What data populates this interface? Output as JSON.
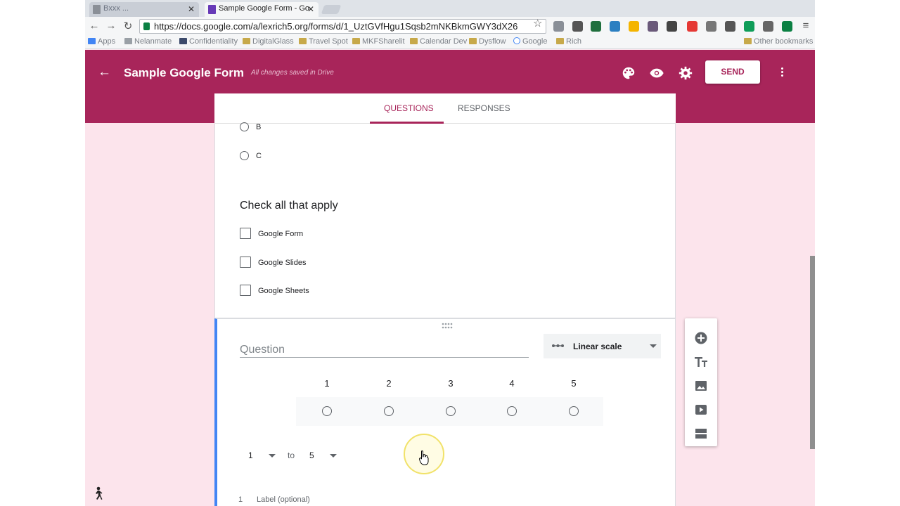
{
  "browser": {
    "tabs": [
      {
        "label": "Bxxx  ...",
        "active": false
      },
      {
        "label": "Sample Google Form - Go",
        "active": true
      }
    ],
    "tab_close_glyph": "✕",
    "url": "https://docs.google.com/a/lexrich5.org/forms/d/1_UztGVfHgu1Sqsb2mNKBkmGWY3dX26",
    "bookmarks": [
      "Apps",
      "Nelanmate",
      "Confidentiality",
      "DigitalGlass",
      "Travel Spot",
      "MKFSharelit",
      "Calendar Dev",
      "Dysflow",
      "Google",
      "Rich"
    ],
    "bookmarks_right": "Other bookmarks"
  },
  "header": {
    "title": "Sample Google Form",
    "save_status": "All changes saved in Drive",
    "send_label": "SEND",
    "accent": "#a8255a"
  },
  "form_tabs": {
    "questions": "QUESTIONS",
    "responses": "RESPONSES"
  },
  "mc_question": {
    "options": [
      "B",
      "C"
    ]
  },
  "checkbox_question": {
    "title": "Check all that apply",
    "options": [
      "Google Form",
      "Google Slides",
      "Google Sheets"
    ]
  },
  "linear_scale": {
    "placeholder": "Question",
    "type_label": "Linear scale",
    "scale": [
      "1",
      "2",
      "3",
      "4",
      "5"
    ],
    "range_from": "1",
    "range_to_word": "to",
    "range_to": "5",
    "label_index": "1",
    "label_placeholder": "Label (optional)"
  }
}
